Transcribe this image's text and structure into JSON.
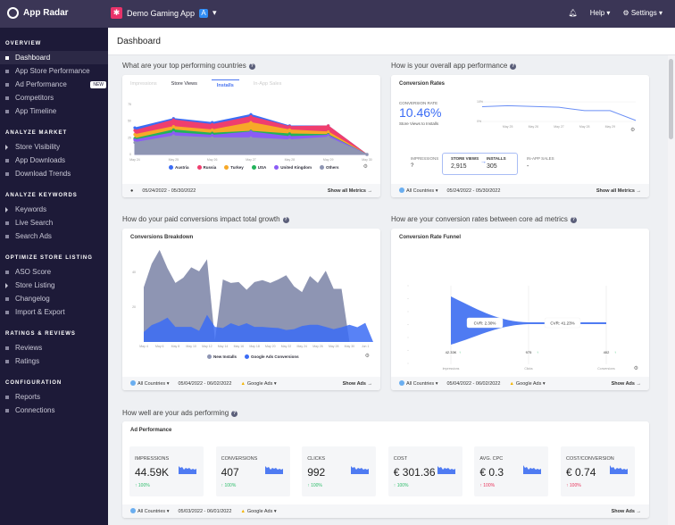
{
  "topbar": {
    "brand": "App Radar",
    "app_name": "Demo Gaming App",
    "help": "Help",
    "settings": "Settings"
  },
  "sidebar": [
    {
      "section": "OVERVIEW",
      "items": [
        {
          "label": "Dashboard",
          "active": true
        },
        {
          "label": "App Store Performance"
        },
        {
          "label": "Ad Performance",
          "badge": "NEW"
        },
        {
          "label": "Competitors"
        },
        {
          "label": "App Timeline"
        }
      ]
    },
    {
      "section": "ANALYZE MARKET",
      "items": [
        {
          "label": "Store Visibility",
          "expandable": true
        },
        {
          "label": "App Downloads"
        },
        {
          "label": "Download Trends"
        }
      ]
    },
    {
      "section": "ANALYZE KEYWORDS",
      "items": [
        {
          "label": "Keywords",
          "expandable": true
        },
        {
          "label": "Live Search"
        },
        {
          "label": "Search Ads"
        }
      ]
    },
    {
      "section": "OPTIMIZE STORE LISTING",
      "items": [
        {
          "label": "ASO Score"
        },
        {
          "label": "Store Listing",
          "expandable": true
        },
        {
          "label": "Changelog"
        },
        {
          "label": "Import & Export"
        }
      ]
    },
    {
      "section": "RATINGS & REVIEWS",
      "items": [
        {
          "label": "Reviews"
        },
        {
          "label": "Ratings"
        }
      ]
    },
    {
      "section": "CONFIGURATION",
      "items": [
        {
          "label": "Reports"
        },
        {
          "label": "Connections"
        }
      ]
    }
  ],
  "page_title": "Dashboard",
  "countries": {
    "question": "What are your top performing countries",
    "tabs": [
      "Impressions",
      "Store Views",
      "Installs",
      "In-App Sales"
    ],
    "active_tab": "Installs",
    "date_range": "05/24/2022 - 05/30/2022",
    "link": "Show all Metrics →"
  },
  "performance": {
    "question": "How is your overall app performance",
    "title": "Conversion Rates",
    "rate_label": "CONVERSION RATE",
    "rate_value": "10.46%",
    "rate_sub": "Store Views to Installs",
    "metrics": [
      {
        "label": "IMPRESSIONS",
        "value": "?"
      },
      {
        "label": "STORE VIEWS",
        "value": "2,915"
      },
      {
        "label": "INSTALLS",
        "value": "305"
      },
      {
        "label": "IN-APP SALES",
        "value": "-"
      }
    ],
    "country": "All Countries",
    "date_range": "05/24/2022 - 05/30/2022",
    "link": "Show all Metrics →"
  },
  "growth": {
    "question": "How do your paid conversions impact total growth",
    "title": "Conversions Breakdown",
    "country": "All Countries",
    "date_range": "05/04/2022 - 06/02/2022",
    "source": "Google Ads",
    "link": "Show Ads →"
  },
  "funnel": {
    "question": "How are your conversion rates between core ad metrics",
    "title": "Conversion Rate Funnel",
    "country": "All Countries",
    "date_range": "05/04/2022 - 06/02/2022",
    "source": "Google Ads",
    "link": "Show Ads →"
  },
  "ads": {
    "question": "How well are your ads performing",
    "title": "Ad Performance",
    "kpis": [
      {
        "label": "IMPRESSIONS",
        "value": "44.59K",
        "change": "100%",
        "trend": "up",
        "good": true
      },
      {
        "label": "CONVERSIONS",
        "value": "407",
        "change": "100%",
        "trend": "up",
        "good": true
      },
      {
        "label": "CLICKS",
        "value": "992",
        "change": "100%",
        "trend": "up",
        "good": true
      },
      {
        "label": "COST",
        "value": "€ 301.36",
        "change": "100%",
        "trend": "up",
        "good": true
      },
      {
        "label": "AVG. CPC",
        "value": "€ 0.3",
        "change": "100%",
        "trend": "up",
        "good": false
      },
      {
        "label": "COST/CONVERSION",
        "value": "€ 0.74",
        "change": "100%",
        "trend": "up",
        "good": false
      }
    ],
    "country": "All Countries",
    "date_range": "05/03/2022 - 06/01/2022",
    "source": "Google Ads",
    "link": "Show Ads →"
  },
  "colors": {
    "accent": "#4a74f0",
    "sidebar": "#1d1a38",
    "topbar": "#3b3656",
    "positive": "#2ebd6b",
    "negative": "#e8335a"
  },
  "chart_data": [
    {
      "type": "area",
      "stacked": true,
      "x": [
        "May 24",
        "May 25",
        "May 26",
        "May 27",
        "May 28",
        "May 29",
        "May 30"
      ],
      "yticks": [
        "0",
        "25",
        "50",
        "75"
      ],
      "ylim": [
        0,
        75
      ],
      "legend": "bottom",
      "series": [
        {
          "name": "Others",
          "color": "#8e95b3",
          "values": [
            18,
            28,
            25,
            25,
            22,
            26,
            0
          ]
        },
        {
          "name": "United Kingdom",
          "color": "#8b5cf6",
          "values": [
            4,
            5,
            4,
            9,
            5,
            3,
            0
          ]
        },
        {
          "name": "USA",
          "color": "#22b35a",
          "values": [
            2,
            4,
            3,
            1,
            4,
            1,
            0
          ]
        },
        {
          "name": "Turkey",
          "color": "#f7a928",
          "values": [
            6,
            5,
            5,
            13,
            6,
            4,
            0
          ]
        },
        {
          "name": "Russia",
          "color": "#ef3e6e",
          "values": [
            6,
            10,
            8,
            9,
            5,
            9,
            0
          ]
        },
        {
          "name": "Austria",
          "color": "#3b6cf5",
          "values": [
            4,
            2,
            3,
            3,
            1,
            0,
            0
          ]
        }
      ],
      "legend_order": [
        "Austria",
        "Russia",
        "Turkey",
        "USA",
        "United Kingdom",
        "Others"
      ]
    },
    {
      "type": "line",
      "x": [
        "May 24",
        "May 25",
        "May 26",
        "May 27",
        "May 28",
        "May 29",
        "May 30"
      ],
      "xticks": [
        "May 25",
        "May 26",
        "May 27",
        "May 28",
        "May 29"
      ],
      "yticks": [
        "0%",
        "10%"
      ],
      "ylim": [
        0,
        10
      ],
      "values": [
        7.5,
        8,
        7.6,
        7.2,
        5.5,
        5.5,
        0.5
      ]
    },
    {
      "type": "area",
      "x": [
        "May 4",
        "May 5",
        "May 6",
        "May 7",
        "May 8",
        "May 9",
        "May 10",
        "May 11",
        "May 12",
        "May 13",
        "May 14",
        "May 15",
        "May 16",
        "May 17",
        "May 18",
        "May 19",
        "May 20",
        "May 21",
        "May 22",
        "May 23",
        "May 24",
        "May 25",
        "May 26",
        "May 27",
        "May 28",
        "May 29",
        "May 30",
        "May 31",
        "Jun 1",
        "Jun 2"
      ],
      "xticks": [
        "May 4",
        "May 6",
        "May 8",
        "May 10",
        "May 12",
        "May 14",
        "May 16",
        "May 18",
        "May 20",
        "May 22",
        "May 24",
        "May 26",
        "May 28",
        "May 30",
        "Jun 1"
      ],
      "yticks": [
        "20",
        "40"
      ],
      "ylim": [
        0,
        55
      ],
      "legend": "bottom",
      "series": [
        {
          "name": "New Installs",
          "color": "#8e95b3",
          "values": [
            31.5,
            45,
            53,
            42.5,
            34,
            37,
            43,
            40.7,
            47.6,
            1,
            36,
            34,
            34.5,
            30,
            34.5,
            35.6,
            34,
            36,
            38.4,
            32,
            28.7,
            38,
            34,
            41,
            30.6,
            30.6,
            0,
            0,
            0,
            0
          ]
        },
        {
          "name": "Google Ads Conversions",
          "color": "#3b6cf5",
          "values": [
            5.7,
            9.7,
            11.5,
            14,
            8.7,
            8.7,
            8.7,
            6.4,
            15.6,
            8.7,
            8,
            10.8,
            9.2,
            10.8,
            8.7,
            8.7,
            8.3,
            8,
            6.9,
            7.4,
            9.2,
            9.9,
            9.9,
            8.7,
            7.4,
            8.5,
            9.9,
            8.5,
            11,
            0
          ]
        }
      ]
    },
    {
      "type": "funnel",
      "stages": [
        {
          "label": "Impressions",
          "value": "42.33K"
        },
        {
          "label": "Clicks",
          "value": "975"
        },
        {
          "label": "Conversions",
          "value": "402"
        }
      ],
      "rates": [
        "CVR: 2.30%",
        "CVR: 41.23%"
      ]
    }
  ]
}
